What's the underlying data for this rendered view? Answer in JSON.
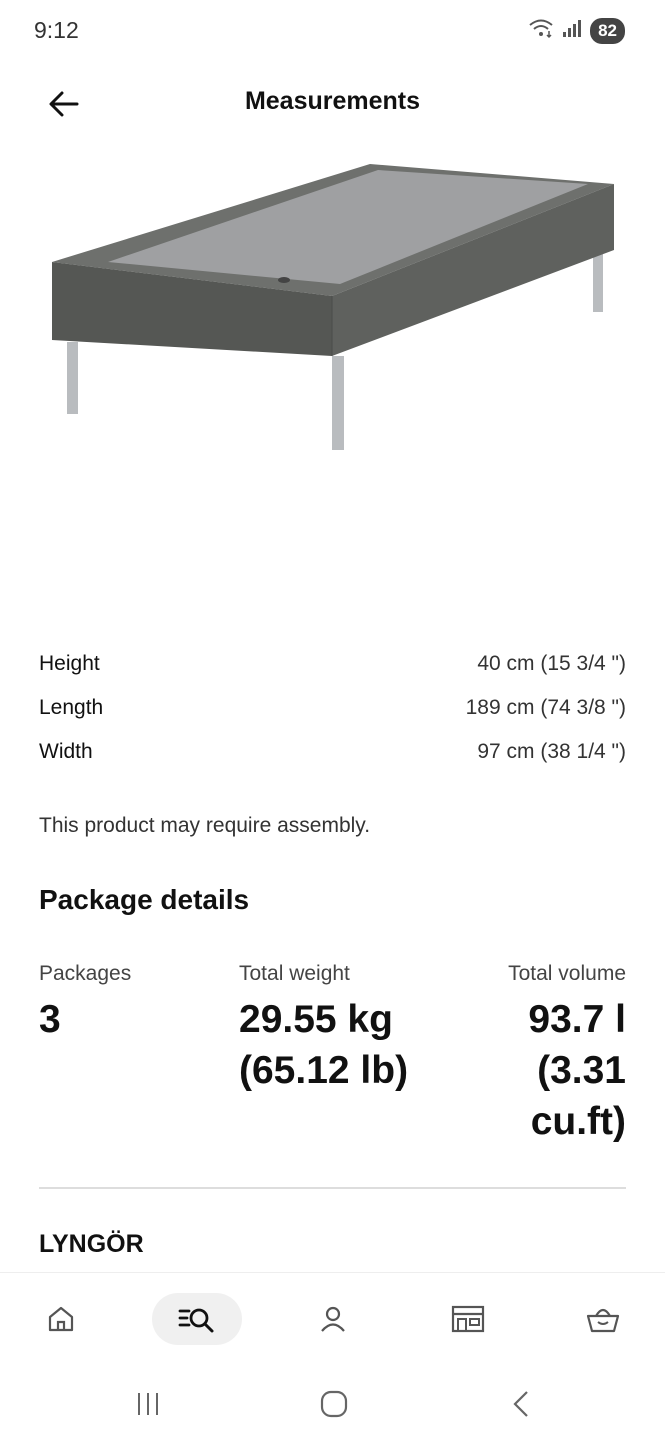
{
  "status_bar": {
    "time": "9:12",
    "battery": "82"
  },
  "header": {
    "title": "Measurements"
  },
  "measurements": [
    {
      "label": "Height",
      "value": "40 cm (15 3/4 \")"
    },
    {
      "label": "Length",
      "value": "189 cm (74 3/8 \")"
    },
    {
      "label": "Width",
      "value": "97 cm (38 1/4 \")"
    }
  ],
  "assembly_note": "This product may require assembly.",
  "package_details": {
    "title": "Package details",
    "packages": {
      "label": "Packages",
      "value": "3"
    },
    "total_weight": {
      "label": "Total weight",
      "value_line1": "29.55 kg",
      "value_line2": "(65.12 lb)"
    },
    "total_volume": {
      "label": "Total volume",
      "value_line1": "93.7 l",
      "value_line2": "(3.31",
      "value_line3": "cu.ft)"
    }
  },
  "product_name": "LYNGÖR",
  "bottom_nav": {
    "items": [
      "home-icon",
      "search-list-icon",
      "profile-icon",
      "store-icon",
      "basket-icon"
    ],
    "active": "search-list-icon"
  },
  "colors": {
    "bed_frame": "#5a5c59",
    "bed_top": "#9fa0a2",
    "legs": "#b9bcbf",
    "divider": "#dddddd",
    "active_nav_bg": "#f0f0f0"
  }
}
